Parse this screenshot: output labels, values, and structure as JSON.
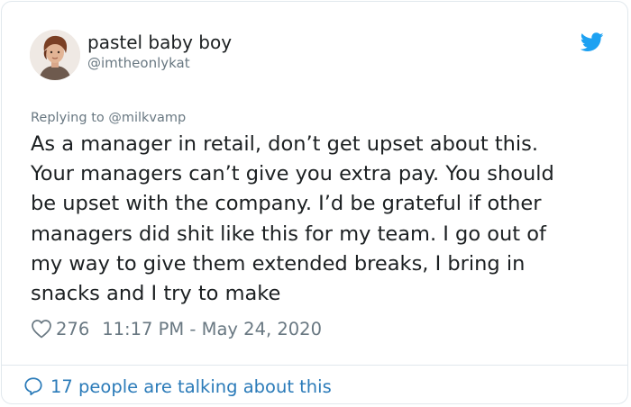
{
  "tweet": {
    "author": {
      "display_name": "pastel baby boy",
      "handle": "@imtheonlykat",
      "avatar_icon": "user-avatar-illustration"
    },
    "platform_icon": "twitter-bird-icon",
    "reply_context": "Replying to @milkvamp",
    "text_lines": [
      "As a manager in retail, don’t get upset about this.",
      "Your managers can’t give you extra pay. You should",
      "be upset with the company. I’d be grateful if other",
      "managers did shit like this for my team. I go out of",
      "my way to give them extended breaks, I bring in",
      "snacks and I try to make"
    ],
    "likes": "276",
    "timestamp": "11:17 PM - May 24, 2020",
    "conversation_link": "17 people are talking about this"
  },
  "colors": {
    "text_primary": "#1c2022",
    "text_secondary": "#697882",
    "twitter_blue": "#1da1f2",
    "link_blue": "#2b7bb9",
    "border": "#e1e8ed"
  }
}
